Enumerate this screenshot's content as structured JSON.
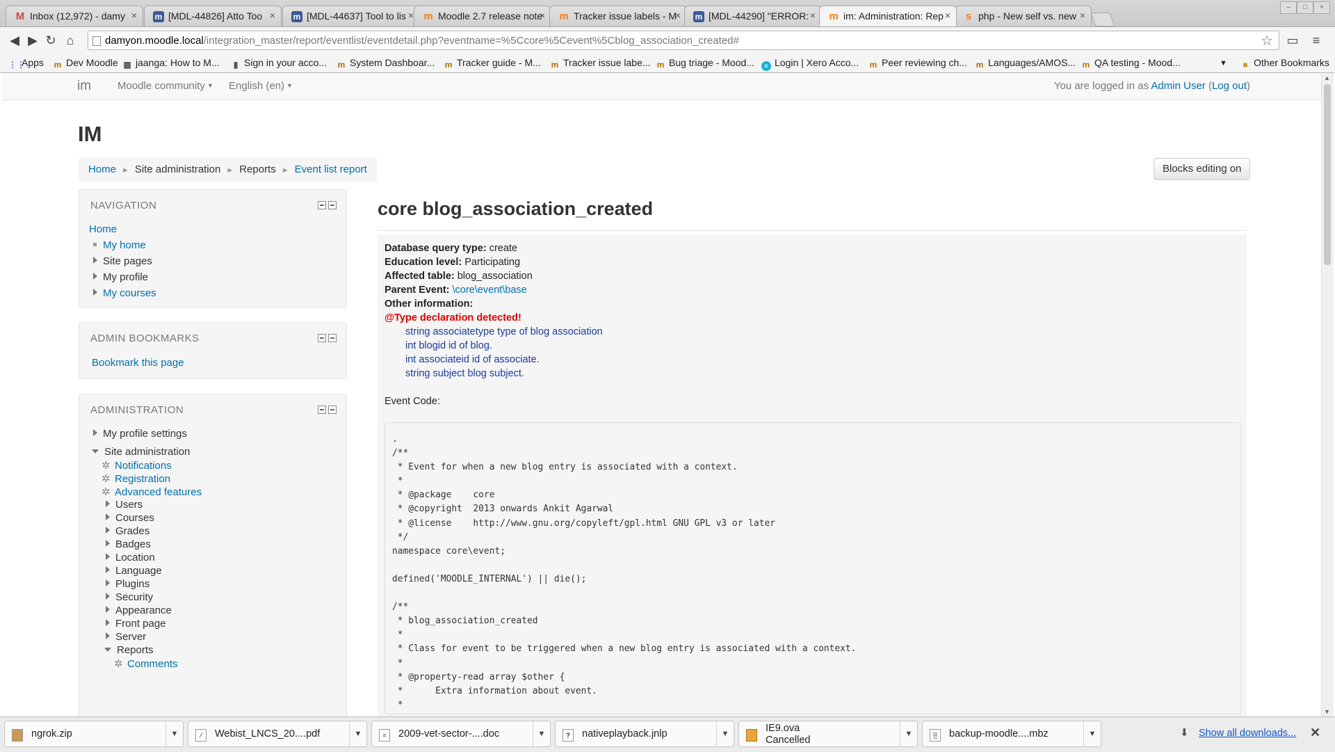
{
  "tabs": [
    {
      "title": "Inbox (12,972) - damy",
      "icon": "gmail-icon",
      "glyph": "M",
      "color": "#d44638",
      "active": false
    },
    {
      "title": "[MDL-44826] Atto Too",
      "icon": "jira-icon",
      "glyph": "m",
      "color": "#3b5998",
      "active": false
    },
    {
      "title": "[MDL-44637] Tool to lis",
      "icon": "jira-icon",
      "glyph": "m",
      "color": "#3b5998",
      "active": false
    },
    {
      "title": "Moodle 2.7 release note",
      "icon": "moodle-icon",
      "glyph": "m",
      "color": "#f98012",
      "active": false
    },
    {
      "title": "Tracker issue labels - M",
      "icon": "moodle-icon",
      "glyph": "m",
      "color": "#f98012",
      "active": false
    },
    {
      "title": "[MDL-44290] \"ERROR:",
      "icon": "jira-icon",
      "glyph": "m",
      "color": "#3b5998",
      "active": false
    },
    {
      "title": "im: Administration: Rep",
      "icon": "moodle-icon",
      "glyph": "m",
      "color": "#f98012",
      "active": true
    },
    {
      "title": "php - New self vs. new",
      "icon": "stackoverflow-icon",
      "glyph": "s",
      "color": "#f48024",
      "active": false
    }
  ],
  "address": {
    "host": "damyon.moodle.local",
    "path": "/integration_master/report/eventlist/eventdetail.php?eventname=%5Ccore%5Cevent%5Cblog_association_created#"
  },
  "bookmarks": [
    {
      "label": "Apps",
      "icon": "apps-icon"
    },
    {
      "label": "Dev Moodle",
      "icon": "moodle-icon"
    },
    {
      "label": "jaanga: How to M...",
      "icon": "page-icon"
    },
    {
      "label": "Sign in your acco...",
      "icon": "page-icon"
    },
    {
      "label": "System Dashboar...",
      "icon": "moodle-icon"
    },
    {
      "label": "Tracker guide - M...",
      "icon": "moodle-icon"
    },
    {
      "label": "Tracker issue labe...",
      "icon": "moodle-icon"
    },
    {
      "label": "Bug triage - Mood...",
      "icon": "moodle-icon"
    },
    {
      "label": "Login | Xero Acco...",
      "icon": "xero-icon"
    },
    {
      "label": "Peer reviewing ch...",
      "icon": "moodle-icon"
    },
    {
      "label": "Languages/AMOS...",
      "icon": "moodle-icon"
    },
    {
      "label": "QA testing - Mood...",
      "icon": "moodle-icon"
    },
    {
      "label": "Other Bookmarks",
      "icon": "folder-icon"
    }
  ],
  "navbar": {
    "brand": "im",
    "community": "Moodle community",
    "language": "English (en)",
    "logged_prefix": "You are logged in as ",
    "user": "Admin User",
    "logout_open": " (",
    "logout": "Log out",
    "logout_close": ")"
  },
  "site_title": "IM",
  "breadcrumb": [
    "Home",
    "Site administration",
    "Reports",
    "Event list report"
  ],
  "blocks_editing_label": "Blocks editing on",
  "navigation": {
    "title": "NAVIGATION",
    "home": "Home",
    "items": [
      "My home",
      "Site pages",
      "My profile",
      "My courses"
    ]
  },
  "admin_bookmarks": {
    "title": "ADMIN BOOKMARKS",
    "link": "Bookmark this page"
  },
  "administration": {
    "title": "ADMINISTRATION",
    "profile_settings": "My profile settings",
    "site_admin": "Site administration",
    "gear_items": [
      "Notifications",
      "Registration",
      "Advanced features"
    ],
    "items": [
      "Users",
      "Courses",
      "Grades",
      "Badges",
      "Location",
      "Language",
      "Plugins",
      "Security",
      "Appearance",
      "Front page",
      "Server",
      "Reports"
    ],
    "reports_children": [
      "Comments"
    ]
  },
  "event": {
    "title": "core blog_association_created",
    "db_label": "Database query type:",
    "db_value": " create",
    "edu_label": "Education level:",
    "edu_value": " Participating",
    "table_label": "Affected table:",
    "table_value": " blog_association",
    "parent_label": "Parent Event:",
    "parent_value": "\\core\\event\\base",
    "other_label": "Other information:",
    "warning": "@Type declaration detected!",
    "other_lines": [
      "string associatetype type of blog association",
      "int blogid id of blog.",
      "int associateid id of associate.",
      "string subject blog subject."
    ],
    "code_label": "Event Code:",
    "code": ".\n/**\n * Event for when a new blog entry is associated with a context.\n *\n * @package    core\n * @copyright  2013 onwards Ankit Agarwal\n * @license    http://www.gnu.org/copyleft/gpl.html GNU GPL v3 or later\n */\nnamespace core\\event;\n\ndefined('MOODLE_INTERNAL') || die();\n\n/**\n * blog_association_created\n *\n * Class for event to be triggered when a new blog entry is associated with a context.\n *\n * @property-read array $other {\n *      Extra information about event.\n *\n *      @type string associatetype type of blog association, course/coursemodule."
  },
  "downloads": [
    {
      "name": "ngrok.zip",
      "icon": "zip-icon"
    },
    {
      "name": "Webist_LNCS_20....pdf",
      "icon": "pdf-icon"
    },
    {
      "name": "2009-vet-sector-....doc",
      "icon": "doc-icon"
    },
    {
      "name": "nativeplayback.jnlp",
      "icon": "file-icon"
    },
    {
      "name": "IE9.ova",
      "status": "Cancelled",
      "icon": "package-icon"
    },
    {
      "name": "backup-moodle....mbz",
      "icon": "file-icon"
    }
  ],
  "show_all_downloads": "Show all downloads..."
}
